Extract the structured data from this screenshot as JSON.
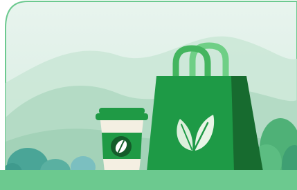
{
  "illustration": {
    "subject": "eco shopping",
    "icons": [
      "coffee-cup-icon",
      "coffee-bean-icon",
      "shopping-bag-icon",
      "leaf-icon"
    ]
  },
  "colors": {
    "frame_green": "#5cbd7a",
    "sky_top": "#e6f3ec",
    "sky_bottom": "#cfe9dc",
    "hill_light": "#b9ddca",
    "hill_mid": "#9fd0b7",
    "bush_teal": "#4fa89a",
    "bush_green": "#57b97e",
    "ground": "#6cc98f",
    "bag_front": "#1e9a46",
    "bag_side": "#176b2f",
    "bag_handle": "#57c46e",
    "cup_green": "#1f9a45",
    "cup_cream": "#f4efe2",
    "leaf_light": "#dcefdc"
  }
}
